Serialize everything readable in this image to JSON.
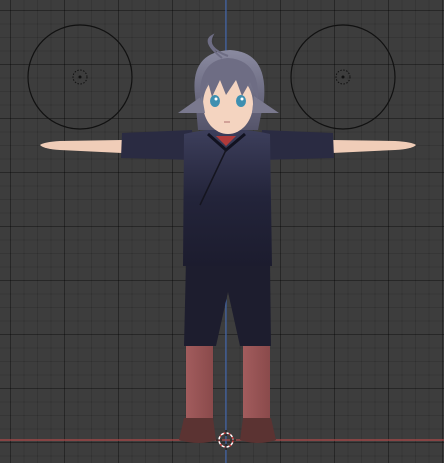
{
  "viewport": {
    "view": "front-orthographic",
    "grid": "on",
    "colors": {
      "background": "#3d3d3d",
      "axis_z": "#4a6fb5",
      "axis_x": "#b34a4a",
      "light_circle": "#111111",
      "skin": "#f0cdb8",
      "hair": "#6b6a80",
      "outfit": "#232336",
      "legs": "#9d5758",
      "shoes": "#5b3332",
      "cursor": "#d64040"
    }
  },
  "objects": {
    "light_left": "light-icon",
    "light_right": "light-icon",
    "character": "anime-character-t-pose",
    "cursor_3d": "3d-cursor-icon"
  }
}
